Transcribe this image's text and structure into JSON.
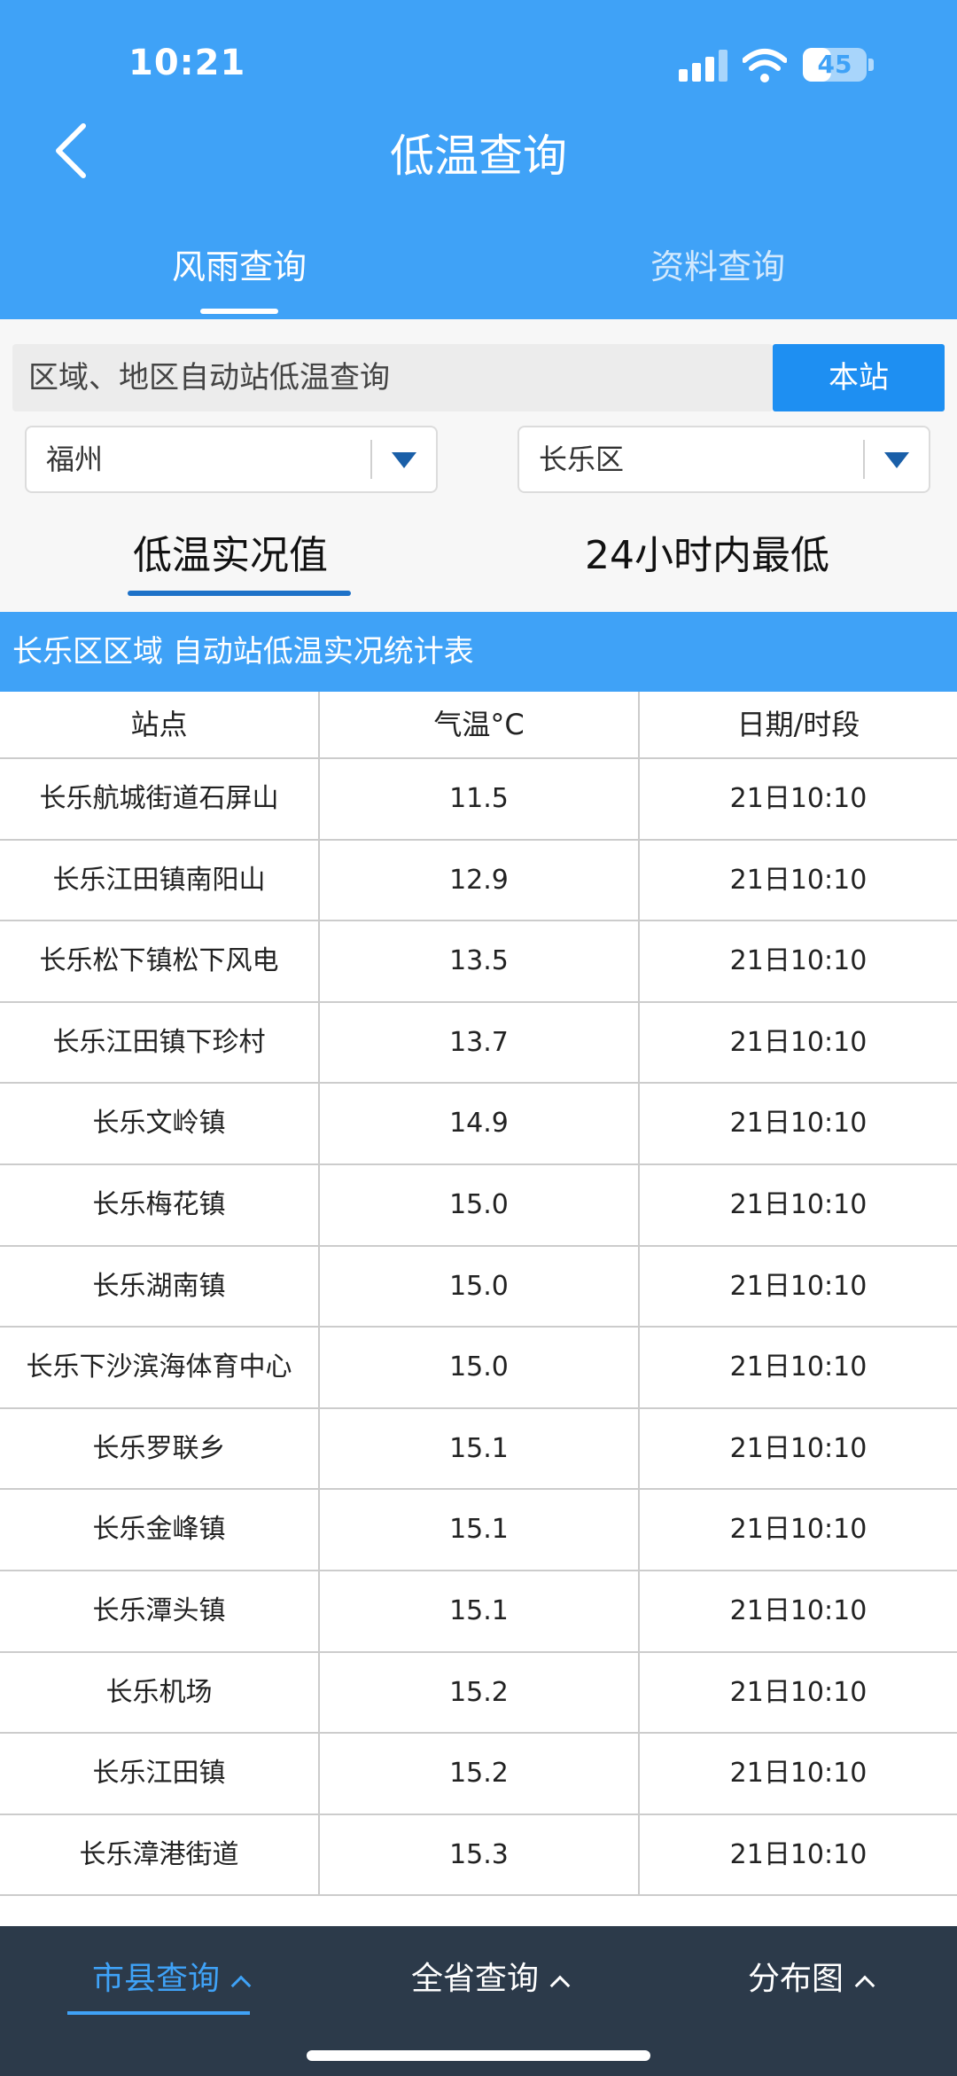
{
  "status": {
    "time": "10:21",
    "battery": "45",
    "battery_level": 0.45
  },
  "nav": {
    "title": "低温查询",
    "back_icon": "chevron-left-icon"
  },
  "top_tabs": [
    "风雨查询",
    "资料查询"
  ],
  "search": {
    "label": "区域、地区自动站低温查询",
    "local_button": "本站"
  },
  "selects": {
    "city": "福州",
    "district": "长乐区"
  },
  "sub_tabs": [
    "低温实况值",
    "24小时内最低"
  ],
  "table": {
    "title": "长乐区区域 自动站低温实况统计表",
    "headers": [
      "站点",
      "气温°C",
      "日期/时段"
    ],
    "rows": [
      [
        "长乐航城街道石屏山",
        "11.5",
        "21日10:10"
      ],
      [
        "长乐江田镇南阳山",
        "12.9",
        "21日10:10"
      ],
      [
        "长乐松下镇松下风电",
        "13.5",
        "21日10:10"
      ],
      [
        "长乐江田镇下珍村",
        "13.7",
        "21日10:10"
      ],
      [
        "长乐文岭镇",
        "14.9",
        "21日10:10"
      ],
      [
        "长乐梅花镇",
        "15.0",
        "21日10:10"
      ],
      [
        "长乐湖南镇",
        "15.0",
        "21日10:10"
      ],
      [
        "长乐下沙滨海体育中心",
        "15.0",
        "21日10:10"
      ],
      [
        "长乐罗联乡",
        "15.1",
        "21日10:10"
      ],
      [
        "长乐金峰镇",
        "15.1",
        "21日10:10"
      ],
      [
        "长乐潭头镇",
        "15.1",
        "21日10:10"
      ],
      [
        "长乐机场",
        "15.2",
        "21日10:10"
      ],
      [
        "长乐江田镇",
        "15.2",
        "21日10:10"
      ],
      [
        "长乐漳港街道",
        "15.3",
        "21日10:10"
      ]
    ]
  },
  "bottom_nav": [
    "市县查询",
    "全省查询",
    "分布图"
  ],
  "colors": {
    "primary": "#3fa2f7",
    "button": "#1e8ff2",
    "bottom_bar": "#2c3a4a"
  }
}
